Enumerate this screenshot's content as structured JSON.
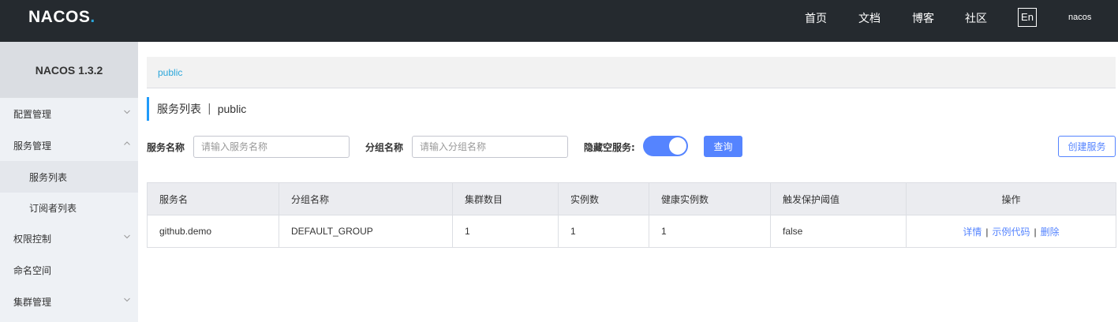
{
  "header": {
    "logo_text": "NACOS",
    "logo_dot": ".",
    "nav": [
      "首页",
      "文档",
      "博客",
      "社区"
    ],
    "lang": "En",
    "user": "nacos"
  },
  "sidebar": {
    "title": "NACOS 1.3.2",
    "items": [
      {
        "label": "配置管理",
        "chevron": "down"
      },
      {
        "label": "服务管理",
        "chevron": "up"
      },
      {
        "label": "服务列表",
        "sub": true,
        "active": true
      },
      {
        "label": "订阅者列表",
        "sub": true
      },
      {
        "label": "权限控制",
        "chevron": "down"
      },
      {
        "label": "命名空间"
      },
      {
        "label": "集群管理",
        "chevron": "down"
      }
    ]
  },
  "breadcrumb": "public",
  "page": {
    "title": "服务列表",
    "separator": "|",
    "namespace": "public"
  },
  "filters": {
    "service_label": "服务名称",
    "service_placeholder": "请输入服务名称",
    "group_label": "分组名称",
    "group_placeholder": "请输入分组名称",
    "hide_empty_label": "隐藏空服务:",
    "hide_empty_on": true,
    "query_button": "查询",
    "create_button": "创建服务"
  },
  "table": {
    "columns": [
      "服务名",
      "分组名称",
      "集群数目",
      "实例数",
      "健康实例数",
      "触发保护阈值",
      "操作"
    ],
    "rows": [
      {
        "service": "github.demo",
        "group": "DEFAULT_GROUP",
        "clusters": "1",
        "instances": "1",
        "healthy": "1",
        "threshold": "false",
        "actions": [
          "详情",
          "示例代码",
          "删除"
        ]
      }
    ]
  },
  "colors": {
    "topbar": "#252a2f",
    "primary": "#5584ff",
    "breadcrumb": "#2aa6da",
    "sidebar": "#eef1f5"
  }
}
